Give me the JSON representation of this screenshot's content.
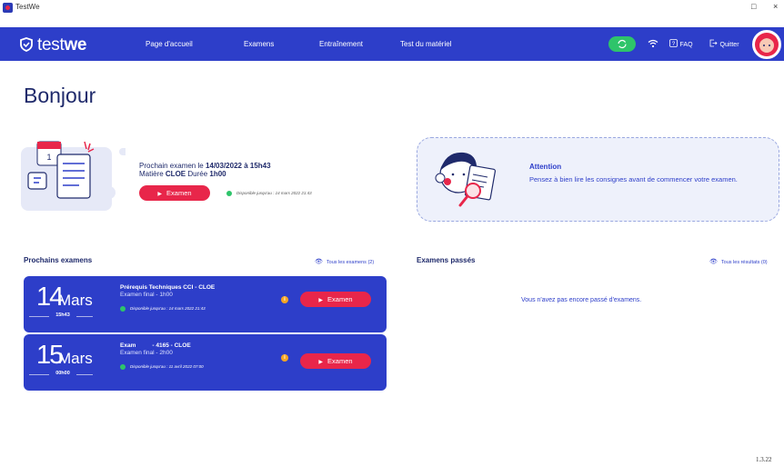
{
  "window": {
    "title": "TestWe",
    "minimize": "□",
    "close": "×"
  },
  "nav": {
    "brand_light": "test",
    "brand_bold": "we",
    "items": [
      "Page d'accueil",
      "Examens",
      "Entraînement",
      "Test du matériel"
    ],
    "faq": "FAQ",
    "quit": "Quitter"
  },
  "greeting": "Bonjour",
  "next_exam": {
    "line1_prefix": "Prochain examen le ",
    "line1_date": "14/03/2022 à 15h43",
    "line2_prefix": "Matière ",
    "line2_subject": "CLOE",
    "line2_duration_label": " Durée ",
    "line2_duration": "1h00",
    "button": "Examen",
    "available": "Disponible jusqu'au : 14 mars 2022 21:43"
  },
  "attention": {
    "title": "Attention",
    "text": "Pensez à bien lire les consignes avant de commencer votre examen."
  },
  "upcoming": {
    "title": "Prochains examens",
    "link": "Tous les examens (2)",
    "exams": [
      {
        "day": "14",
        "month": "Mars",
        "time": "15h43",
        "title": "Prérequis Techniques CCI - CLOE",
        "sub": "Examen final - 1h00",
        "available": "Disponible jusqu'au : 14 mars 2022 21:43",
        "button": "Examen"
      },
      {
        "day": "15",
        "month": "Mars",
        "time": "00h00",
        "title": "Exam          - 4165 - CLOE",
        "sub": "Examen final - 2h00",
        "available": "Disponible jusqu'au : 11 avril 2022 07:00",
        "button": "Examen"
      }
    ]
  },
  "past": {
    "title": "Examens passés",
    "link": "Tous les résultats (0)",
    "empty": "Vous n'avez pas encore passé d'examens."
  },
  "version": "1.3.22",
  "colors": {
    "primary": "#2d3ec9",
    "accent": "#e8264a",
    "success": "#2ec46a",
    "warning": "#f5a623"
  }
}
